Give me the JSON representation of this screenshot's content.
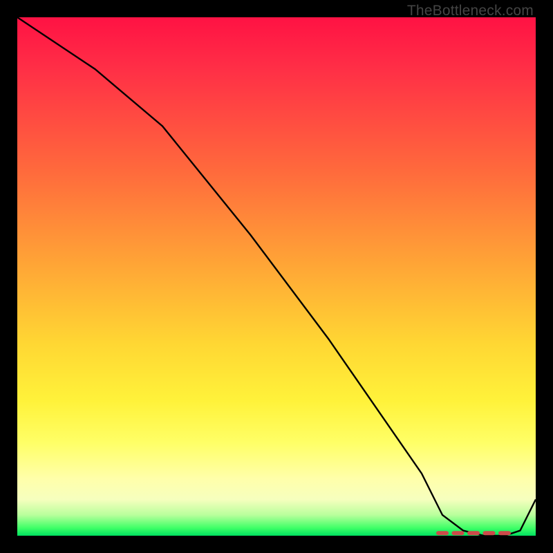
{
  "watermark": "TheBottleneck.com",
  "chart_data": {
    "type": "line",
    "title": "",
    "xlabel": "",
    "ylabel": "",
    "xlim": [
      0,
      100
    ],
    "ylim": [
      0,
      100
    ],
    "series": [
      {
        "name": "bottleneck-curve",
        "x": [
          0,
          15,
          28,
          45,
          60,
          78,
          82,
          86,
          90,
          94,
          97,
          100
        ],
        "values": [
          100,
          90,
          79,
          58,
          38,
          12,
          4,
          1,
          0,
          0,
          1,
          7
        ]
      }
    ],
    "sweet_spot_markers_x": [
      82,
      85,
      88,
      91,
      94
    ],
    "colors": {
      "curve": "#000000",
      "marker": "#cc4a4a"
    }
  }
}
